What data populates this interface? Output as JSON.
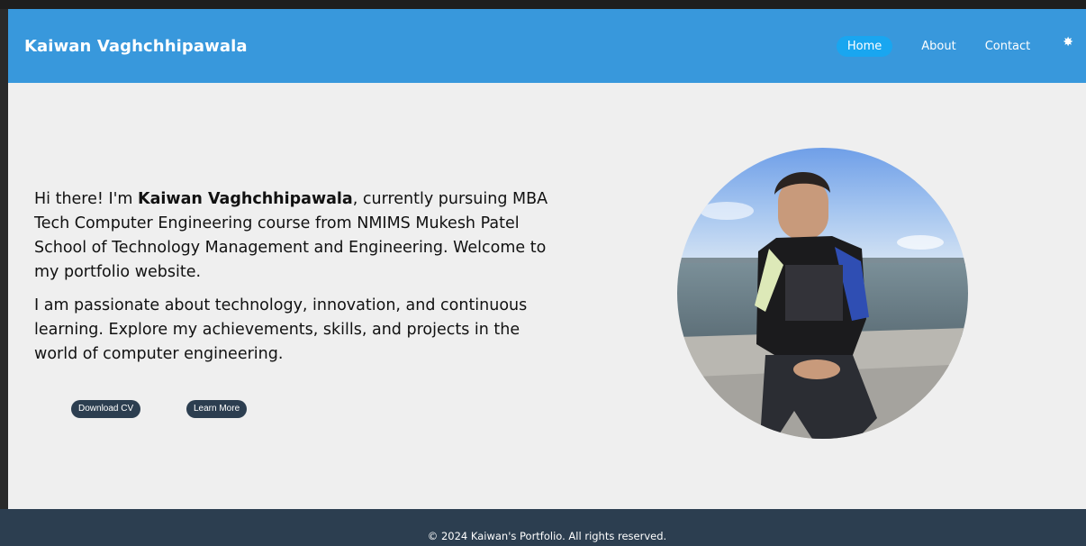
{
  "header": {
    "title": "Kaiwan Vaghchhipawala",
    "nav": [
      "Home",
      "About",
      "Contact"
    ],
    "theme_icon": "sun-icon"
  },
  "main": {
    "intro": {
      "p1_start": "Hi there! I'm ",
      "p1_name": "Kaiwan Vaghchhipawala",
      "p1_end": ", currently pursuing MBA Tech Computer Engineering course from NMIMS Mukesh Patel School of Technology Management and Engineering. Welcome to my portfolio website.",
      "p2": "I am passionate about technology, innovation, and continuous learning. Explore my achievements, skills, and projects in the world of computer engineering."
    },
    "buttons": {
      "download": "Download CV",
      "learn": "Learn More"
    }
  },
  "footer": {
    "text": "© 2024 Kaiwan's Portfolio. All rights reserved."
  },
  "colors": {
    "header_bg": "#3898dc",
    "active_nav": "#19a6f0",
    "button_bg": "#2c3e50",
    "page_bg": "#efefef",
    "footer_bg": "#2c3e50"
  }
}
